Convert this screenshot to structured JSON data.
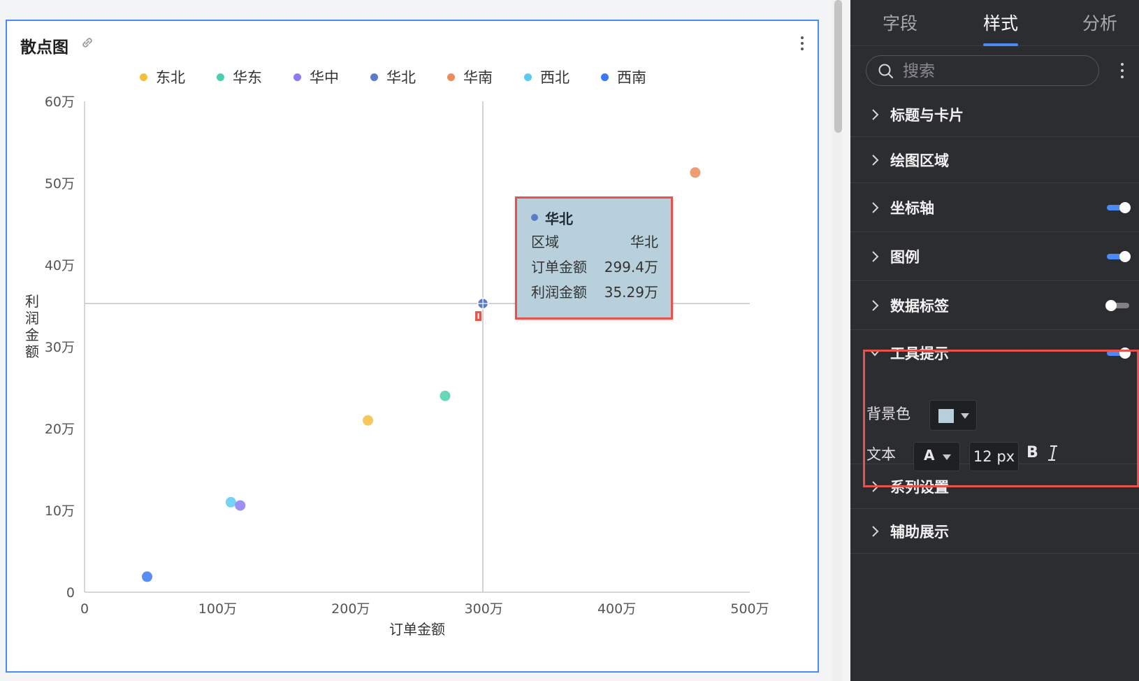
{
  "card": {
    "title": "散点图"
  },
  "legend": [
    {
      "name": "东北",
      "color": "#f6bd3f"
    },
    {
      "name": "华东",
      "color": "#4ccfad"
    },
    {
      "name": "华中",
      "color": "#8b7df0"
    },
    {
      "name": "华北",
      "color": "#5b7bc7"
    },
    {
      "name": "华南",
      "color": "#ea8c5b"
    },
    {
      "name": "西北",
      "color": "#5ccaf0"
    },
    {
      "name": "西南",
      "color": "#3b78f5"
    }
  ],
  "chart_data": {
    "type": "scatter",
    "xlabel": "订单金额",
    "ylabel": "利润金额",
    "x_ticks": [
      "0",
      "100万",
      "200万",
      "300万",
      "400万",
      "500万"
    ],
    "y_ticks": [
      "0",
      "10万",
      "20万",
      "30万",
      "40万",
      "50万",
      "60万"
    ],
    "xlim": [
      0,
      5000000
    ],
    "ylim": [
      0,
      600000
    ],
    "points": [
      {
        "series": "西南",
        "x": 470000,
        "y": 19000
      },
      {
        "series": "西北",
        "x": 1100000,
        "y": 110000
      },
      {
        "series": "华中",
        "x": 1170000,
        "y": 106000
      },
      {
        "series": "东北",
        "x": 2130000,
        "y": 210000
      },
      {
        "series": "华东",
        "x": 2710000,
        "y": 240000
      },
      {
        "series": "华北",
        "x": 2994000,
        "y": 352900
      },
      {
        "series": "华南",
        "x": 4590000,
        "y": 513000
      }
    ],
    "crosshair": {
      "x": 2994000,
      "y": 352900
    }
  },
  "tooltip": {
    "title": "华北",
    "dot_color": "#5b7bc7",
    "rows": [
      {
        "label": "区域",
        "value": "华北"
      },
      {
        "label": "订单金额",
        "value": "299.4万"
      },
      {
        "label": "利润金额",
        "value": "35.29万"
      }
    ],
    "background": "#b8d0db"
  },
  "panel": {
    "tabs": [
      "字段",
      "样式",
      "分析"
    ],
    "active_tab": "样式",
    "search_placeholder": "搜索",
    "sections": [
      {
        "label": "标题与卡片"
      },
      {
        "label": "绘图区域"
      },
      {
        "label": "坐标轴",
        "toggle": "on"
      },
      {
        "label": "图例",
        "toggle": "on"
      },
      {
        "label": "数据标签",
        "toggle": "off"
      },
      {
        "label": "工具提示",
        "toggle": "on"
      },
      {
        "label": "系列设置"
      },
      {
        "label": "辅助展示"
      }
    ],
    "tooltip_opts": {
      "bg_label": "背景色",
      "bg_color": "#b8d0db",
      "text_label": "文本",
      "font_color_letter": "A",
      "font_size": "12 px",
      "bold": "B"
    }
  },
  "colors": {
    "accent": "#4c8bf5",
    "highlight": "#e4534c"
  }
}
